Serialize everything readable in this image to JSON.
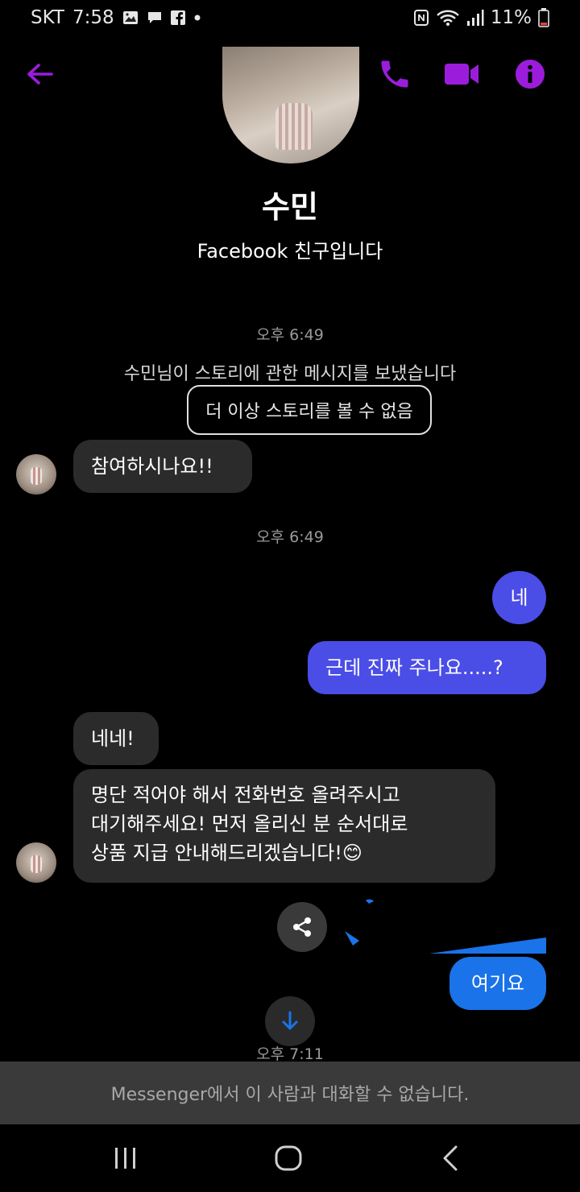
{
  "status_bar": {
    "carrier": "SKT",
    "time": "7:58",
    "battery": "11%",
    "icons": [
      "image-icon",
      "message-icon",
      "facebook-icon",
      "dot-icon",
      "nfc-icon",
      "wifi-icon",
      "signal-icon",
      "battery-icon"
    ]
  },
  "app_bar": {
    "back_icon": "back-arrow-icon",
    "call_icon": "phone-icon",
    "video_icon": "video-camera-icon",
    "info_icon": "info-icon",
    "accent_color": "#9b1ddb"
  },
  "profile": {
    "name": "수민",
    "subtitle": "Facebook 친구입니다"
  },
  "conversation": {
    "timestamp_1": "오후 6:49",
    "story_notice": "수민님이 스토리에 관한 메시지를 보냈습니다",
    "story_unavailable": "더 이상 스토리를 볼 수 없음",
    "msg_1": "참여하시나요!!",
    "timestamp_2": "오후 6:49",
    "msg_2": "네",
    "msg_3": "근데 진짜 주나요.....?",
    "msg_4": "네네!",
    "msg_5_line1": "명단 적어야 해서 전화번호 올려주시고",
    "msg_5_line2": "대기해주세요! 먼저 올리신 분 순서대로",
    "msg_5_line3": "상품 지급 안내해드리겠습니다!",
    "msg_5_emoji": "😊",
    "msg_6": "여기요",
    "timestamp_3": "오후 7:11",
    "outgoing_color": "#4a4de6",
    "incoming_color": "#2b2b2b"
  },
  "composer": {
    "banner": "Messenger에서 이 사람과 대화할 수 없습니다."
  },
  "nav": {
    "recents_icon": "recents-icon",
    "home_icon": "home-icon",
    "back_icon": "nav-back-icon"
  }
}
